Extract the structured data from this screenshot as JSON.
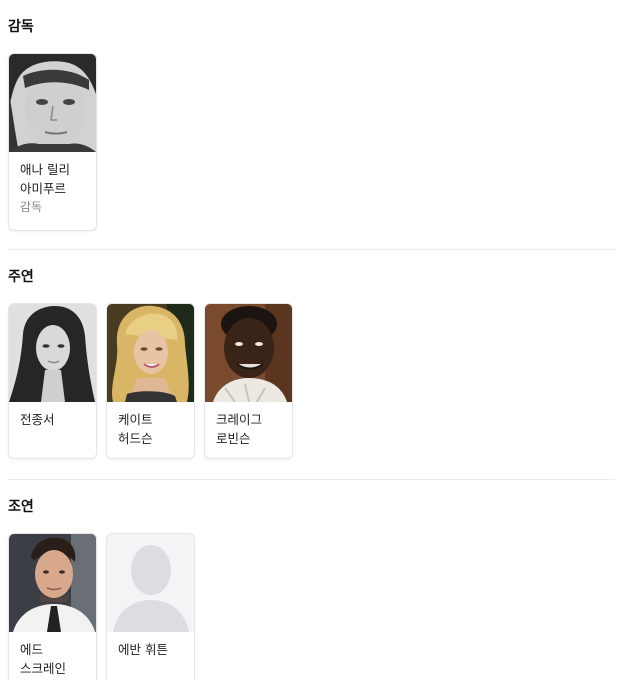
{
  "sections": [
    {
      "title": "감독",
      "people": [
        {
          "name": "애나 릴리 아미푸르",
          "role": "감독",
          "photo": "portrait-bw-woman"
        }
      ]
    },
    {
      "title": "주연",
      "people": [
        {
          "name": "전종서",
          "role": "",
          "photo": "portrait-bw-woman-long-hair"
        },
        {
          "name": "케이트 허드슨",
          "role": "",
          "photo": "portrait-blonde-woman"
        },
        {
          "name": "크레이그 로빈슨",
          "role": "",
          "photo": "portrait-man-dark"
        }
      ]
    },
    {
      "title": "조연",
      "people": [
        {
          "name": "에드 스크레인",
          "role": "",
          "photo": "portrait-man-suit"
        },
        {
          "name": "에반 휘튼",
          "role": "",
          "photo": "placeholder-silhouette-icon"
        }
      ]
    }
  ]
}
